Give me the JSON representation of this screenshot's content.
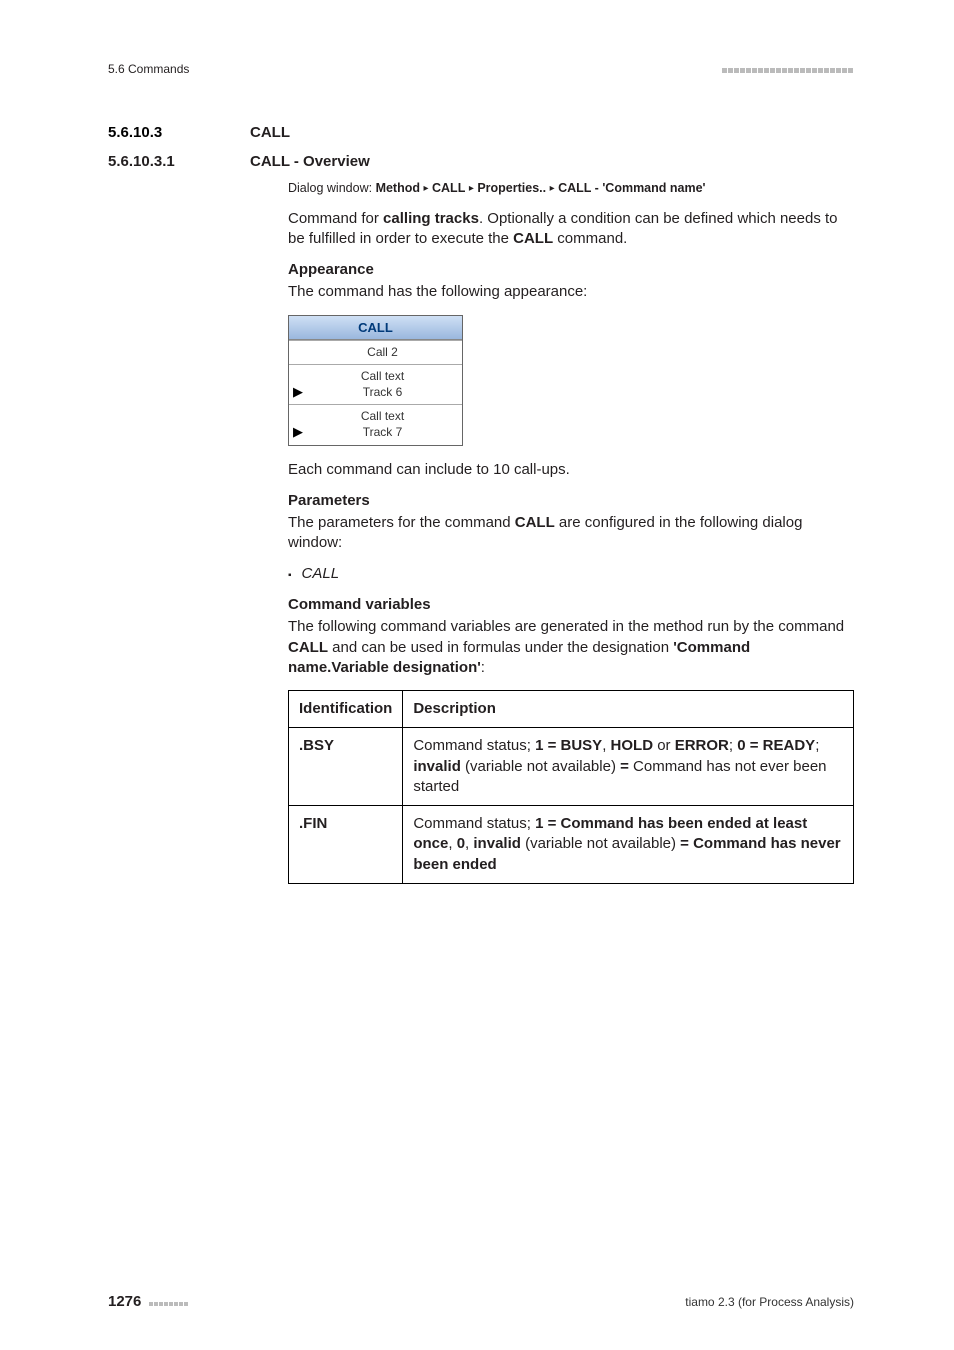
{
  "header": {
    "left": "5.6 Commands"
  },
  "sections": {
    "h3": {
      "num": "5.6.10.3",
      "title": "CALL"
    },
    "h4": {
      "num": "5.6.10.3.1",
      "title": "CALL - Overview"
    }
  },
  "path": {
    "label": "Dialog window:",
    "parts": [
      "Method",
      "CALL",
      "Properties..",
      "CALL - 'Command name'"
    ]
  },
  "intro": {
    "p1_a": "Command for ",
    "p1_b": "calling tracks",
    "p1_c": ". Optionally a condition can be defined which needs to be fulfilled in order to execute the ",
    "p1_d": "CALL",
    "p1_e": " command."
  },
  "appearance": {
    "heading": "Appearance",
    "lead": "The command has the following appearance:",
    "box": {
      "title": "CALL",
      "row1": "Call 2",
      "row2a": "Call text",
      "row2b": "Track 6",
      "row3a": "Call text",
      "row3b": "Track 7"
    },
    "after": "Each command can include to 10 call-ups."
  },
  "parameters": {
    "heading": "Parameters",
    "lead_a": "The parameters for the command ",
    "lead_b": "CALL",
    "lead_c": " are configured in the following dialog window:",
    "item": "CALL"
  },
  "cmdvars": {
    "heading": "Command variables",
    "lead_a": "The following command variables are generated in the method run by the command ",
    "lead_b": "CALL",
    "lead_c": " and can be used in formulas under the designation ",
    "lead_d": "'Command name.Variable designation'",
    "lead_e": ":",
    "th1": "Identification",
    "th2": "Description",
    "rows": [
      {
        "id": ".BSY",
        "d": {
          "a": "Command status; ",
          "b": "1 = BUSY",
          "c": ", ",
          "d": "HOLD",
          "e": " or ",
          "f": "ERROR",
          "g": "; ",
          "h": "0 = READY",
          "i": "; ",
          "j": "invalid",
          "k": " (variable not available) ",
          "l": "=",
          "m": " Command has not ever been started"
        }
      },
      {
        "id": ".FIN",
        "d": {
          "a": "Command status; ",
          "b": "1 = Command has been ended at least once",
          "c": ", ",
          "d": "0",
          "e": ", ",
          "f": "invalid",
          "g": " (variable not available) ",
          "h": "= Command has never been ended"
        }
      }
    ]
  },
  "footer": {
    "page": "1276",
    "app": "tiamo 2.3 (for Process Analysis)"
  }
}
